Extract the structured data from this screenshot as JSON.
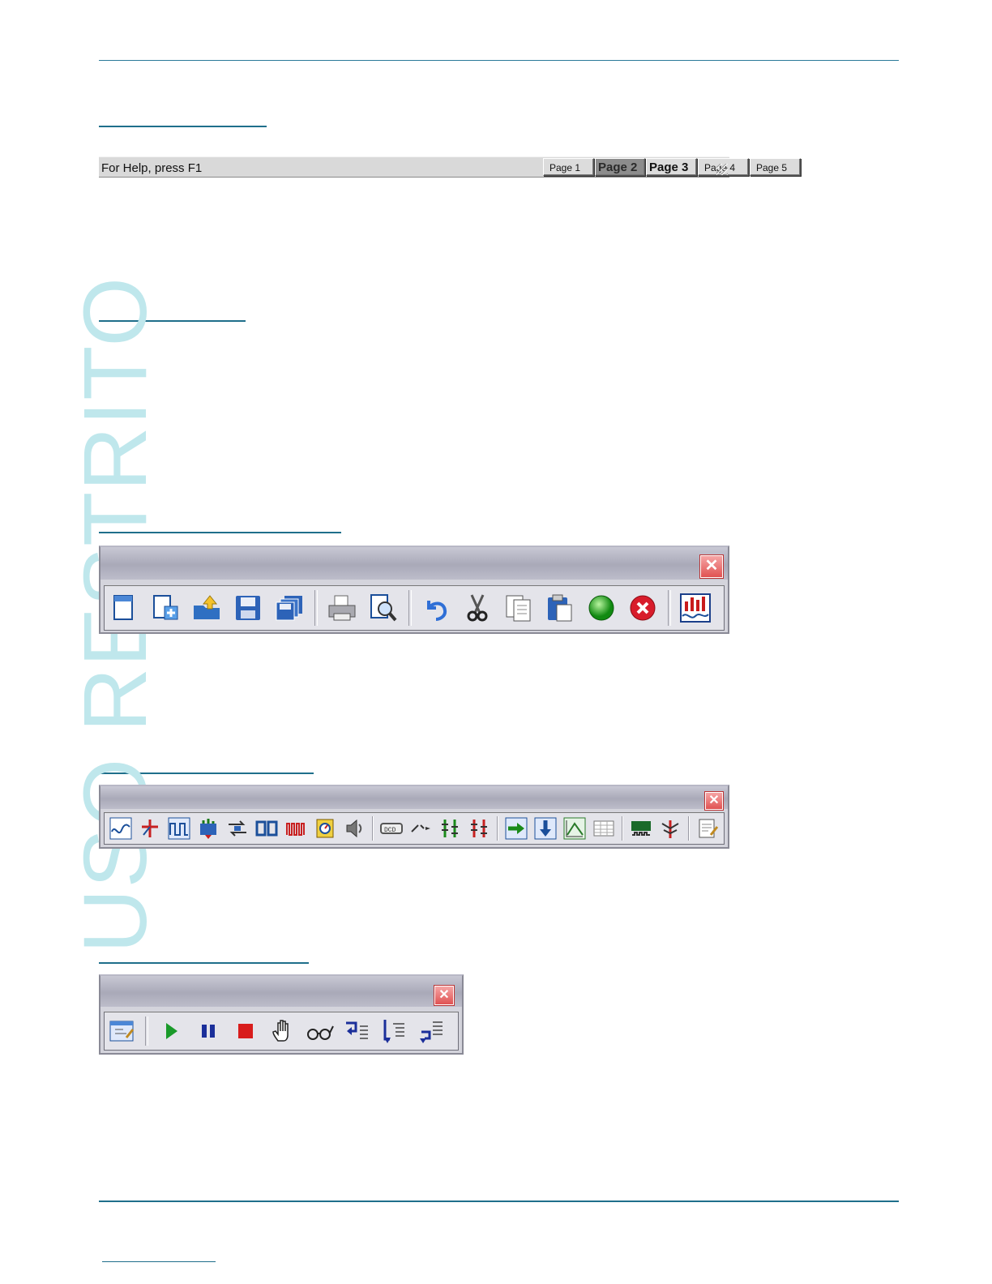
{
  "watermark": "USO RESTRITO",
  "statusbar": {
    "help_text": "For Help, press F1",
    "tabs": [
      {
        "label": "Page 1",
        "style": "small"
      },
      {
        "label": "Page 2",
        "style": "big-active"
      },
      {
        "label": "Page 3",
        "style": "big"
      },
      {
        "label": "Page 4",
        "style": "small"
      },
      {
        "label": "Page 5",
        "style": "small"
      }
    ]
  },
  "toolbar_main": {
    "close_label": "✕",
    "icons": [
      "new-document-icon",
      "new-from-template-icon",
      "open-folder-icon",
      "save-icon",
      "save-all-icon",
      "print-icon",
      "print-preview-icon",
      "undo-icon",
      "cut-icon",
      "copy-icon",
      "paste-icon",
      "run-green-icon",
      "stop-red-icon",
      "chart-icon"
    ]
  },
  "toolbar_instruments": {
    "close_label": "✕",
    "icons": [
      "oscilloscope-icon",
      "function-icon",
      "pulse-icon",
      "signal-source-icon",
      "converter-icon",
      "switch-icon",
      "counter-icon",
      "meter-icon",
      "speaker-icon",
      "display-icon",
      "probe-icon",
      "bus-icon",
      "bus-red-icon",
      "export-right-icon",
      "export-down-icon",
      "graph-icon",
      "table-icon",
      "logic-analyzer-icon",
      "antenna-icon",
      "notes-icon"
    ]
  },
  "toolbar_debug": {
    "close_label": "✕",
    "icons": [
      "edit-icon",
      "play-icon",
      "pause-icon",
      "stop-icon",
      "hand-icon",
      "watch-glasses-icon",
      "step-into-icon",
      "step-over-icon",
      "step-out-icon"
    ]
  },
  "colors": {
    "rule": "#1f6f8b",
    "watermark": "#bfe7ec"
  }
}
